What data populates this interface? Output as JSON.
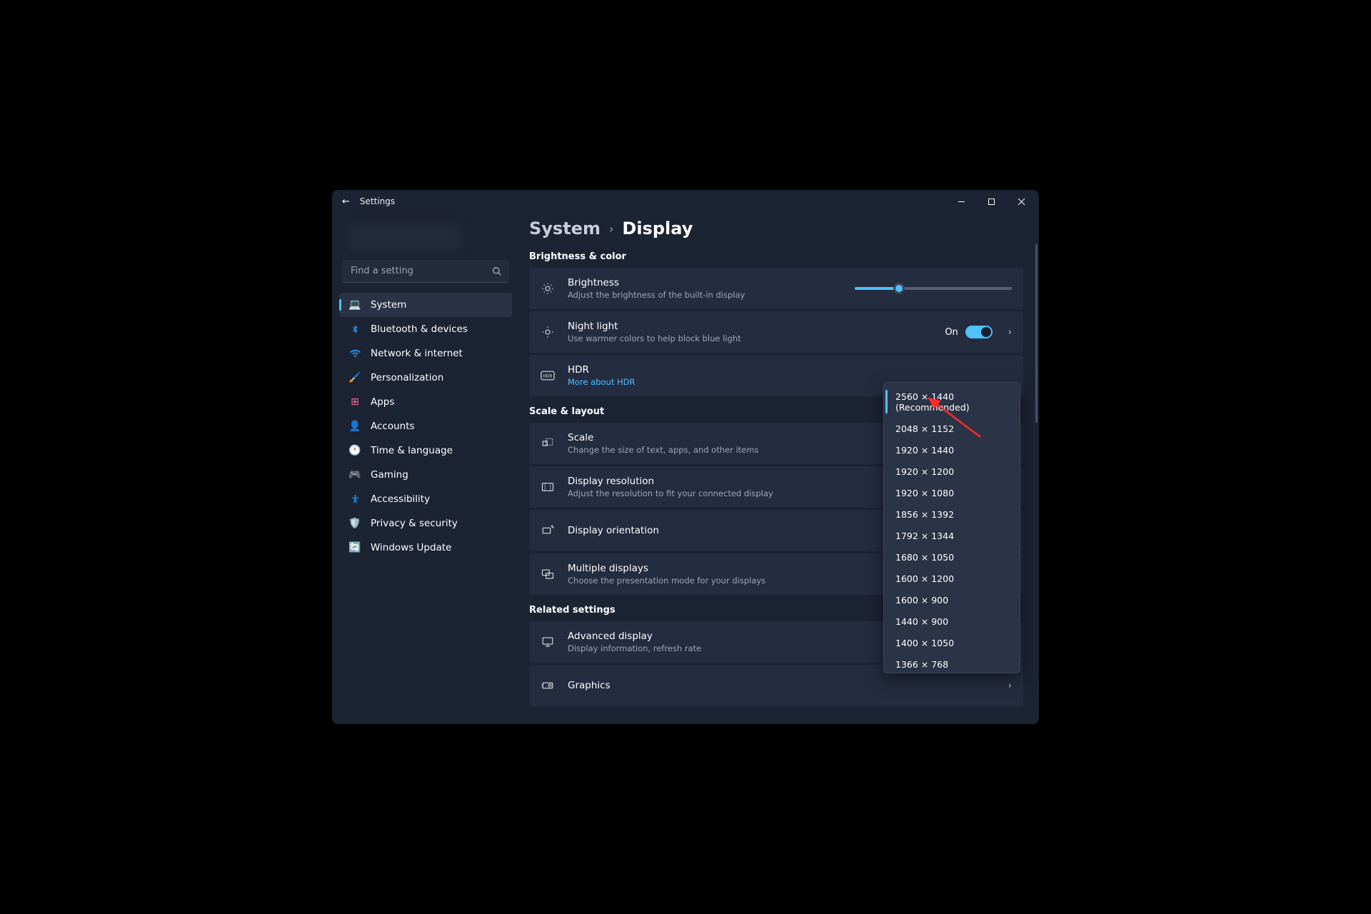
{
  "app_title": "Settings",
  "search": {
    "placeholder": "Find a setting"
  },
  "sidebar": {
    "items": [
      {
        "label": "System",
        "icon": "💻",
        "color": "#4cc2ff",
        "active": true
      },
      {
        "label": "Bluetooth & devices",
        "icon": "bt",
        "color": "#2196f3"
      },
      {
        "label": "Network & internet",
        "icon": "wifi",
        "color": "#2196f3"
      },
      {
        "label": "Personalization",
        "icon": "🖌️",
        "color": "#d97757"
      },
      {
        "label": "Apps",
        "icon": "⊞",
        "color": "#ff6b9d"
      },
      {
        "label": "Accounts",
        "icon": "👤",
        "color": "#4caf50"
      },
      {
        "label": "Time & language",
        "icon": "🕐",
        "color": "#2196f3"
      },
      {
        "label": "Gaming",
        "icon": "🎮",
        "color": "#888"
      },
      {
        "label": "Accessibility",
        "icon": "acc",
        "color": "#2196f3"
      },
      {
        "label": "Privacy & security",
        "icon": "🛡️",
        "color": "#888"
      },
      {
        "label": "Windows Update",
        "icon": "🔄",
        "color": "#2196f3"
      }
    ]
  },
  "breadcrumb": {
    "parent": "System",
    "current": "Display"
  },
  "sections": {
    "brightness": {
      "title": "Brightness & color",
      "brightness": {
        "title": "Brightness",
        "desc": "Adjust the brightness of the built-in display",
        "value": 28
      },
      "nightlight": {
        "title": "Night light",
        "desc": "Use warmer colors to help block blue light",
        "state_label": "On"
      },
      "hdr": {
        "title": "HDR",
        "link": "More about HDR"
      }
    },
    "scale": {
      "title": "Scale & layout",
      "scale": {
        "title": "Scale",
        "desc": "Change the size of text, apps, and other items"
      },
      "resolution": {
        "title": "Display resolution",
        "desc": "Adjust the resolution to fit your connected display"
      },
      "orientation": {
        "title": "Display orientation"
      },
      "multiple": {
        "title": "Multiple displays",
        "desc": "Choose the presentation mode for your displays"
      }
    },
    "related": {
      "title": "Related settings",
      "advanced": {
        "title": "Advanced display",
        "desc": "Display information, refresh rate"
      },
      "graphics": {
        "title": "Graphics"
      }
    }
  },
  "resolution_dropdown": {
    "selected": 0,
    "options": [
      "2560 × 1440 (Recommended)",
      "2048 × 1152",
      "1920 × 1440",
      "1920 × 1200",
      "1920 × 1080",
      "1856 × 1392",
      "1792 × 1344",
      "1680 × 1050",
      "1600 × 1200",
      "1600 × 900",
      "1440 × 900",
      "1400 × 1050",
      "1366 × 768"
    ]
  }
}
